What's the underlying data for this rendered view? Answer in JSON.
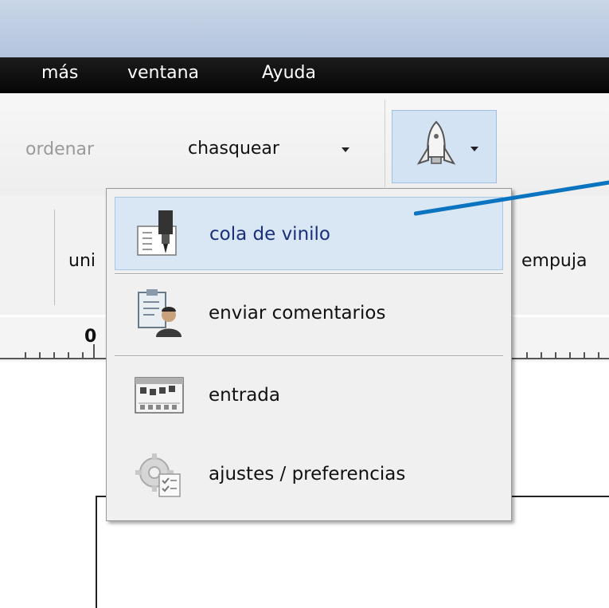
{
  "menubar": {
    "items": [
      "más",
      "ventana",
      "Ayuda"
    ]
  },
  "toolbar": {
    "ordenar_label": "ordenar",
    "chasquear_label": "chasquear"
  },
  "secondrow": {
    "left_label": "uni",
    "right_label": "empuja"
  },
  "ruler": {
    "zero_label": "0"
  },
  "dropdown": {
    "items": [
      {
        "label": "cola de vinilo",
        "icon": "vinyl-cutter-icon",
        "highlighted": true
      },
      {
        "label": "enviar comentarios",
        "icon": "feedback-clipboard-person-icon"
      },
      {
        "label": "entrada",
        "icon": "input-grid-icon"
      },
      {
        "label": "ajustes / preferencias",
        "icon": "settings-gear-checklist-icon"
      }
    ]
  },
  "colors": {
    "highlight_bg": "#d9e6f3",
    "callout_line": "#0a74c0",
    "menubar_bg": "#0d0d0d"
  }
}
